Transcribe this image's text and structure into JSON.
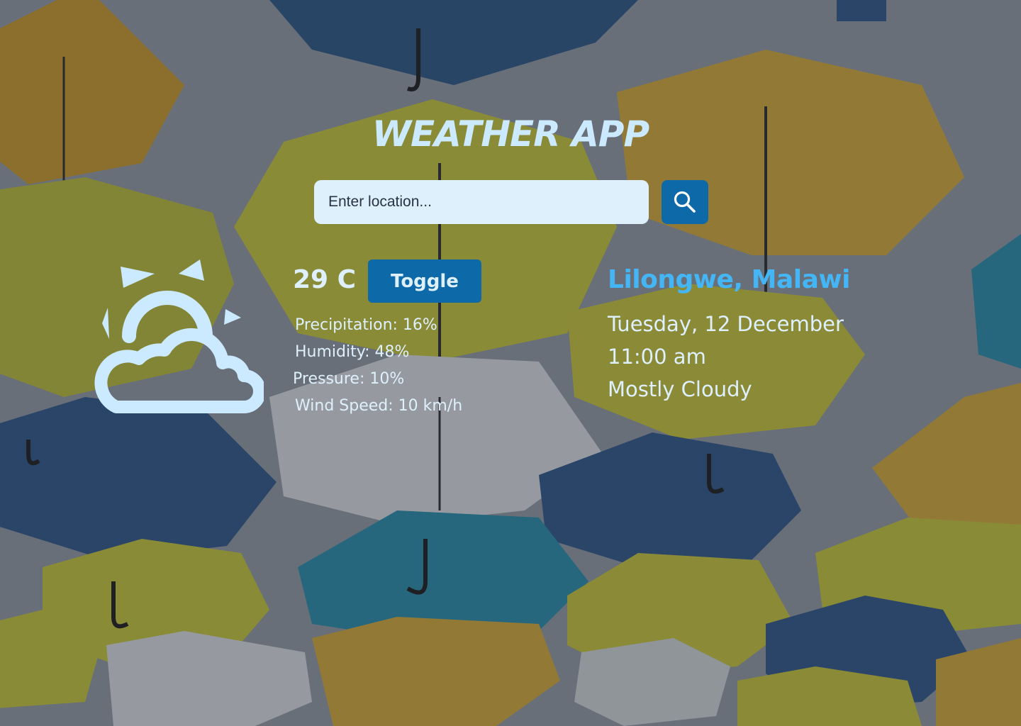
{
  "app": {
    "title": "WEATHER APP"
  },
  "search": {
    "placeholder": "Enter location...",
    "value": "",
    "button_icon": "search-icon"
  },
  "current": {
    "icon": "partly-cloudy-icon",
    "temperature": "29 C",
    "toggle_label": "Toggle",
    "details": {
      "precipitation": "Precipitation: 16%",
      "humidity": "Humidity: 48%",
      "pressure": "Pressure: 10%",
      "wind_speed": "Wind Speed: 10 km/h"
    }
  },
  "location": {
    "name": "Lilongwe, Malawi",
    "date": "Tuesday, 12 December",
    "time": "11:00 am",
    "condition": "Mostly Cloudy"
  },
  "colors": {
    "title": "#cbe9ff",
    "accent": "#0e69a8",
    "location": "#44b6f5",
    "text": "#dff0fd",
    "input_bg": "#dff0fd"
  }
}
